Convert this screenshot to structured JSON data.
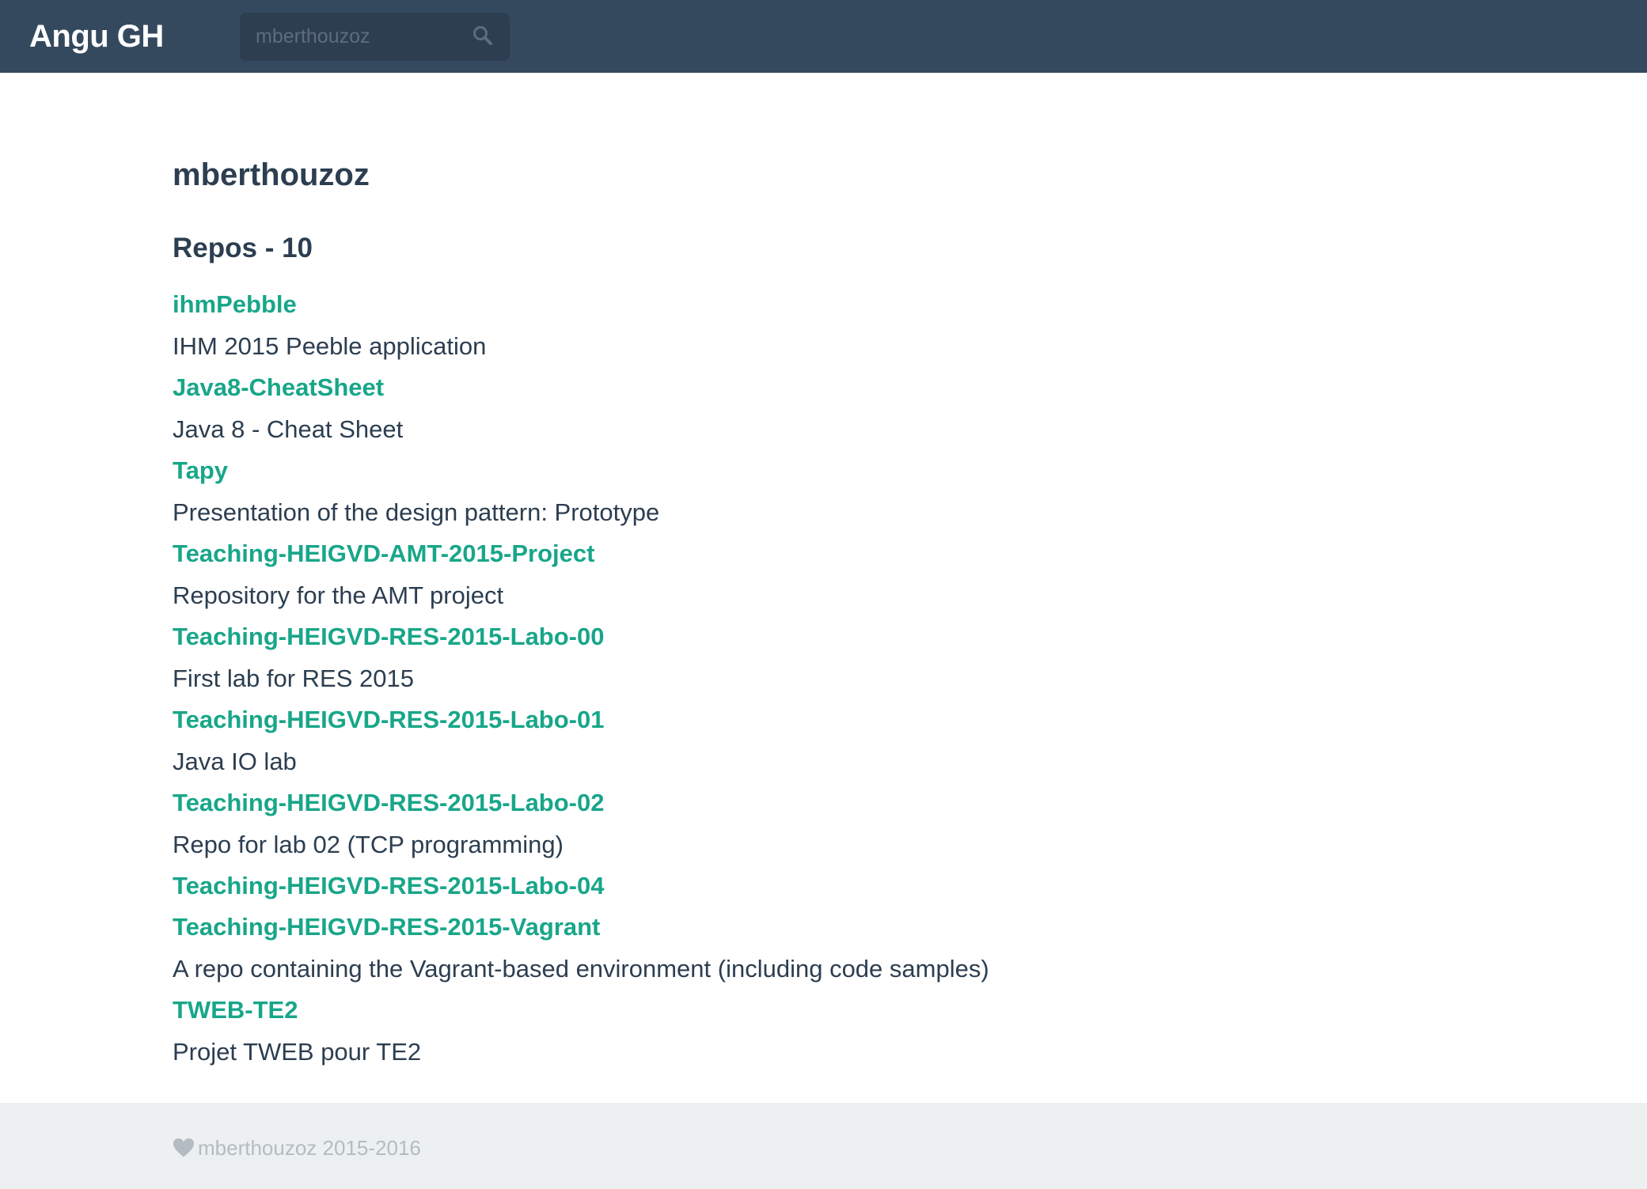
{
  "navbar": {
    "brand": "Angu GH",
    "search": {
      "value": "",
      "placeholder": "mberthouzoz",
      "icon": "search-icon"
    }
  },
  "user": {
    "name": "mberthouzoz"
  },
  "repos_heading": "Repos - 10",
  "repos": [
    {
      "name": "ihmPebble",
      "description": "IHM 2015 Peeble application"
    },
    {
      "name": "Java8-CheatSheet",
      "description": "Java 8 - Cheat Sheet"
    },
    {
      "name": "Tapy",
      "description": "Presentation of the design pattern: Prototype"
    },
    {
      "name": "Teaching-HEIGVD-AMT-2015-Project",
      "description": "Repository for the AMT project"
    },
    {
      "name": "Teaching-HEIGVD-RES-2015-Labo-00",
      "description": "First lab for RES 2015"
    },
    {
      "name": "Teaching-HEIGVD-RES-2015-Labo-01",
      "description": "Java IO lab"
    },
    {
      "name": "Teaching-HEIGVD-RES-2015-Labo-02",
      "description": "Repo for lab 02 (TCP programming)"
    },
    {
      "name": "Teaching-HEIGVD-RES-2015-Labo-04",
      "description": ""
    },
    {
      "name": "Teaching-HEIGVD-RES-2015-Vagrant",
      "description": "A repo containing the Vagrant-based environment (including code samples)"
    },
    {
      "name": "TWEB-TE2",
      "description": "Projet TWEB pour TE2"
    }
  ],
  "footer": {
    "text": "mberthouzoz 2015-2016",
    "icon": "heart-icon"
  },
  "colors": {
    "navbar": "#34495e",
    "search_bg": "#2c3e50",
    "link": "#18a689",
    "text": "#2c3e50",
    "footer_bg": "#ecf0f1",
    "footer_text": "#b4bcc2"
  }
}
